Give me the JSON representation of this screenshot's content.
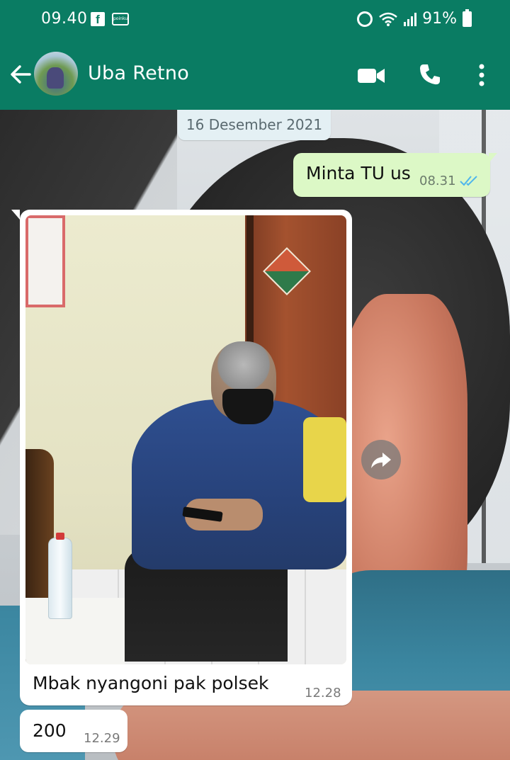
{
  "status_bar": {
    "time": "09.40",
    "battery": "91%",
    "fb_letter": "f",
    "app_badge": "poinku"
  },
  "toolbar": {
    "contact_name": "Uba Retno"
  },
  "chat": {
    "date_chip": "16 Desember 2021",
    "messages": [
      {
        "direction": "outgoing",
        "text": "Minta TU us",
        "time": "08.31",
        "status": "read"
      },
      {
        "direction": "incoming",
        "type": "image",
        "caption": "Mbak nyangoni pak polsek",
        "time": "12.28"
      },
      {
        "direction": "incoming",
        "text": "200",
        "time": "12.29"
      }
    ]
  },
  "colors": {
    "header_green": "#0a7c63",
    "outgoing_bubble": "#dcf8c6",
    "incoming_bubble": "#ffffff",
    "read_ticks": "#4fb6ec"
  },
  "icons": {
    "back": "arrow-left-icon",
    "video": "video-camera-icon",
    "call": "phone-icon",
    "more": "more-vert-icon",
    "share": "forward-share-icon"
  }
}
